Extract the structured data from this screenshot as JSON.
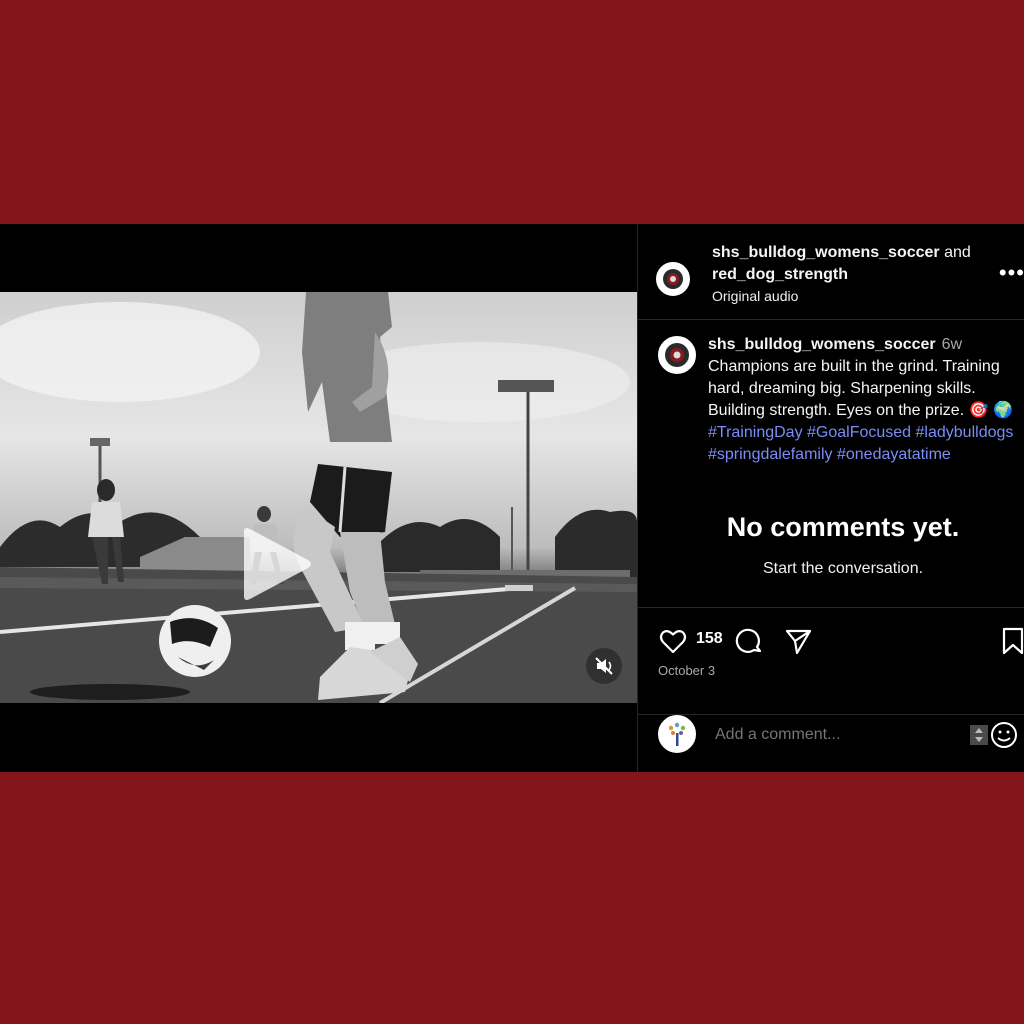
{
  "post": {
    "author": "shs_bulldog_womens_soccer",
    "connector": "and",
    "collaborator": "red_dog_strength",
    "audio": "Original audio",
    "more_label": "•••",
    "caption": {
      "author": "shs_bulldog_womens_soccer",
      "age": "6w",
      "text": "Champions are built in the grind. Training hard, dreaming big. Sharpening skills. Building strength. Eyes on the prize. 🎯",
      "globe": "🌍",
      "hashtags": [
        "#TrainingDay",
        "#GoalFocused",
        "#ladybulldogs",
        "#springdalefamily",
        "#onedayatatime"
      ]
    },
    "empty_comments": {
      "title": "No comments yet.",
      "subtitle": "Start the conversation."
    },
    "likes": "158",
    "date": "October 3",
    "comment_placeholder": "Add a comment..."
  },
  "icons": {
    "like": "heart-icon",
    "comment": "comment-bubble-icon",
    "share": "paper-plane-icon",
    "save": "bookmark-icon",
    "play": "play-icon",
    "mute": "muted-speaker-icon",
    "emoji": "emoji-icon"
  },
  "colors": {
    "background": "#84161b",
    "panel": "#000000",
    "hashtag": "#7a8cf6",
    "muted_text": "#a8a8a8"
  }
}
